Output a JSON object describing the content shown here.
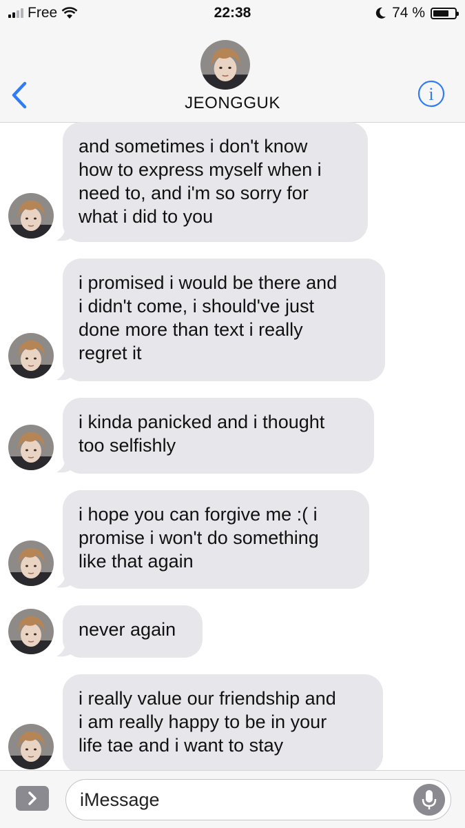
{
  "status_bar": {
    "carrier": "Free",
    "time": "22:38",
    "battery_text": "74 %",
    "battery_level": 0.74,
    "icons": [
      "signal-icon",
      "wifi-icon",
      "moon-icon",
      "battery-icon"
    ]
  },
  "header": {
    "contact_name": "JEONGGUK",
    "icons": [
      "back-chevron-icon",
      "contact-avatar",
      "info-icon"
    ]
  },
  "messages": [
    {
      "sender": "contact",
      "lines": [
        "and sometimes i don't know",
        "how to express myself when i",
        "need to, and i'm so sorry for",
        "what i did to you"
      ]
    },
    {
      "sender": "contact",
      "lines": [
        "i promised i would be there and",
        "i didn't come, i should've just",
        "done more than text i really",
        "regret it"
      ]
    },
    {
      "sender": "contact",
      "lines": [
        "i kinda panicked and i thought",
        "too selfishly"
      ]
    },
    {
      "sender": "contact",
      "lines": [
        "i hope you can forgive me :( i",
        "promise i won't do something",
        "like that again"
      ]
    },
    {
      "sender": "contact",
      "lines": [
        "never again"
      ]
    },
    {
      "sender": "contact",
      "lines": [
        "i really value our friendship and",
        "i am really happy to be in your",
        "life tae and i want to stay"
      ]
    }
  ],
  "input_bar": {
    "placeholder": "iMessage",
    "icons": [
      "app-drawer-chevron-icon",
      "microphone-icon"
    ]
  },
  "colors": {
    "accent_blue": "#2f7cf6",
    "bubble_gray": "#e6e6eb",
    "bar_background": "#f6f6f7"
  }
}
